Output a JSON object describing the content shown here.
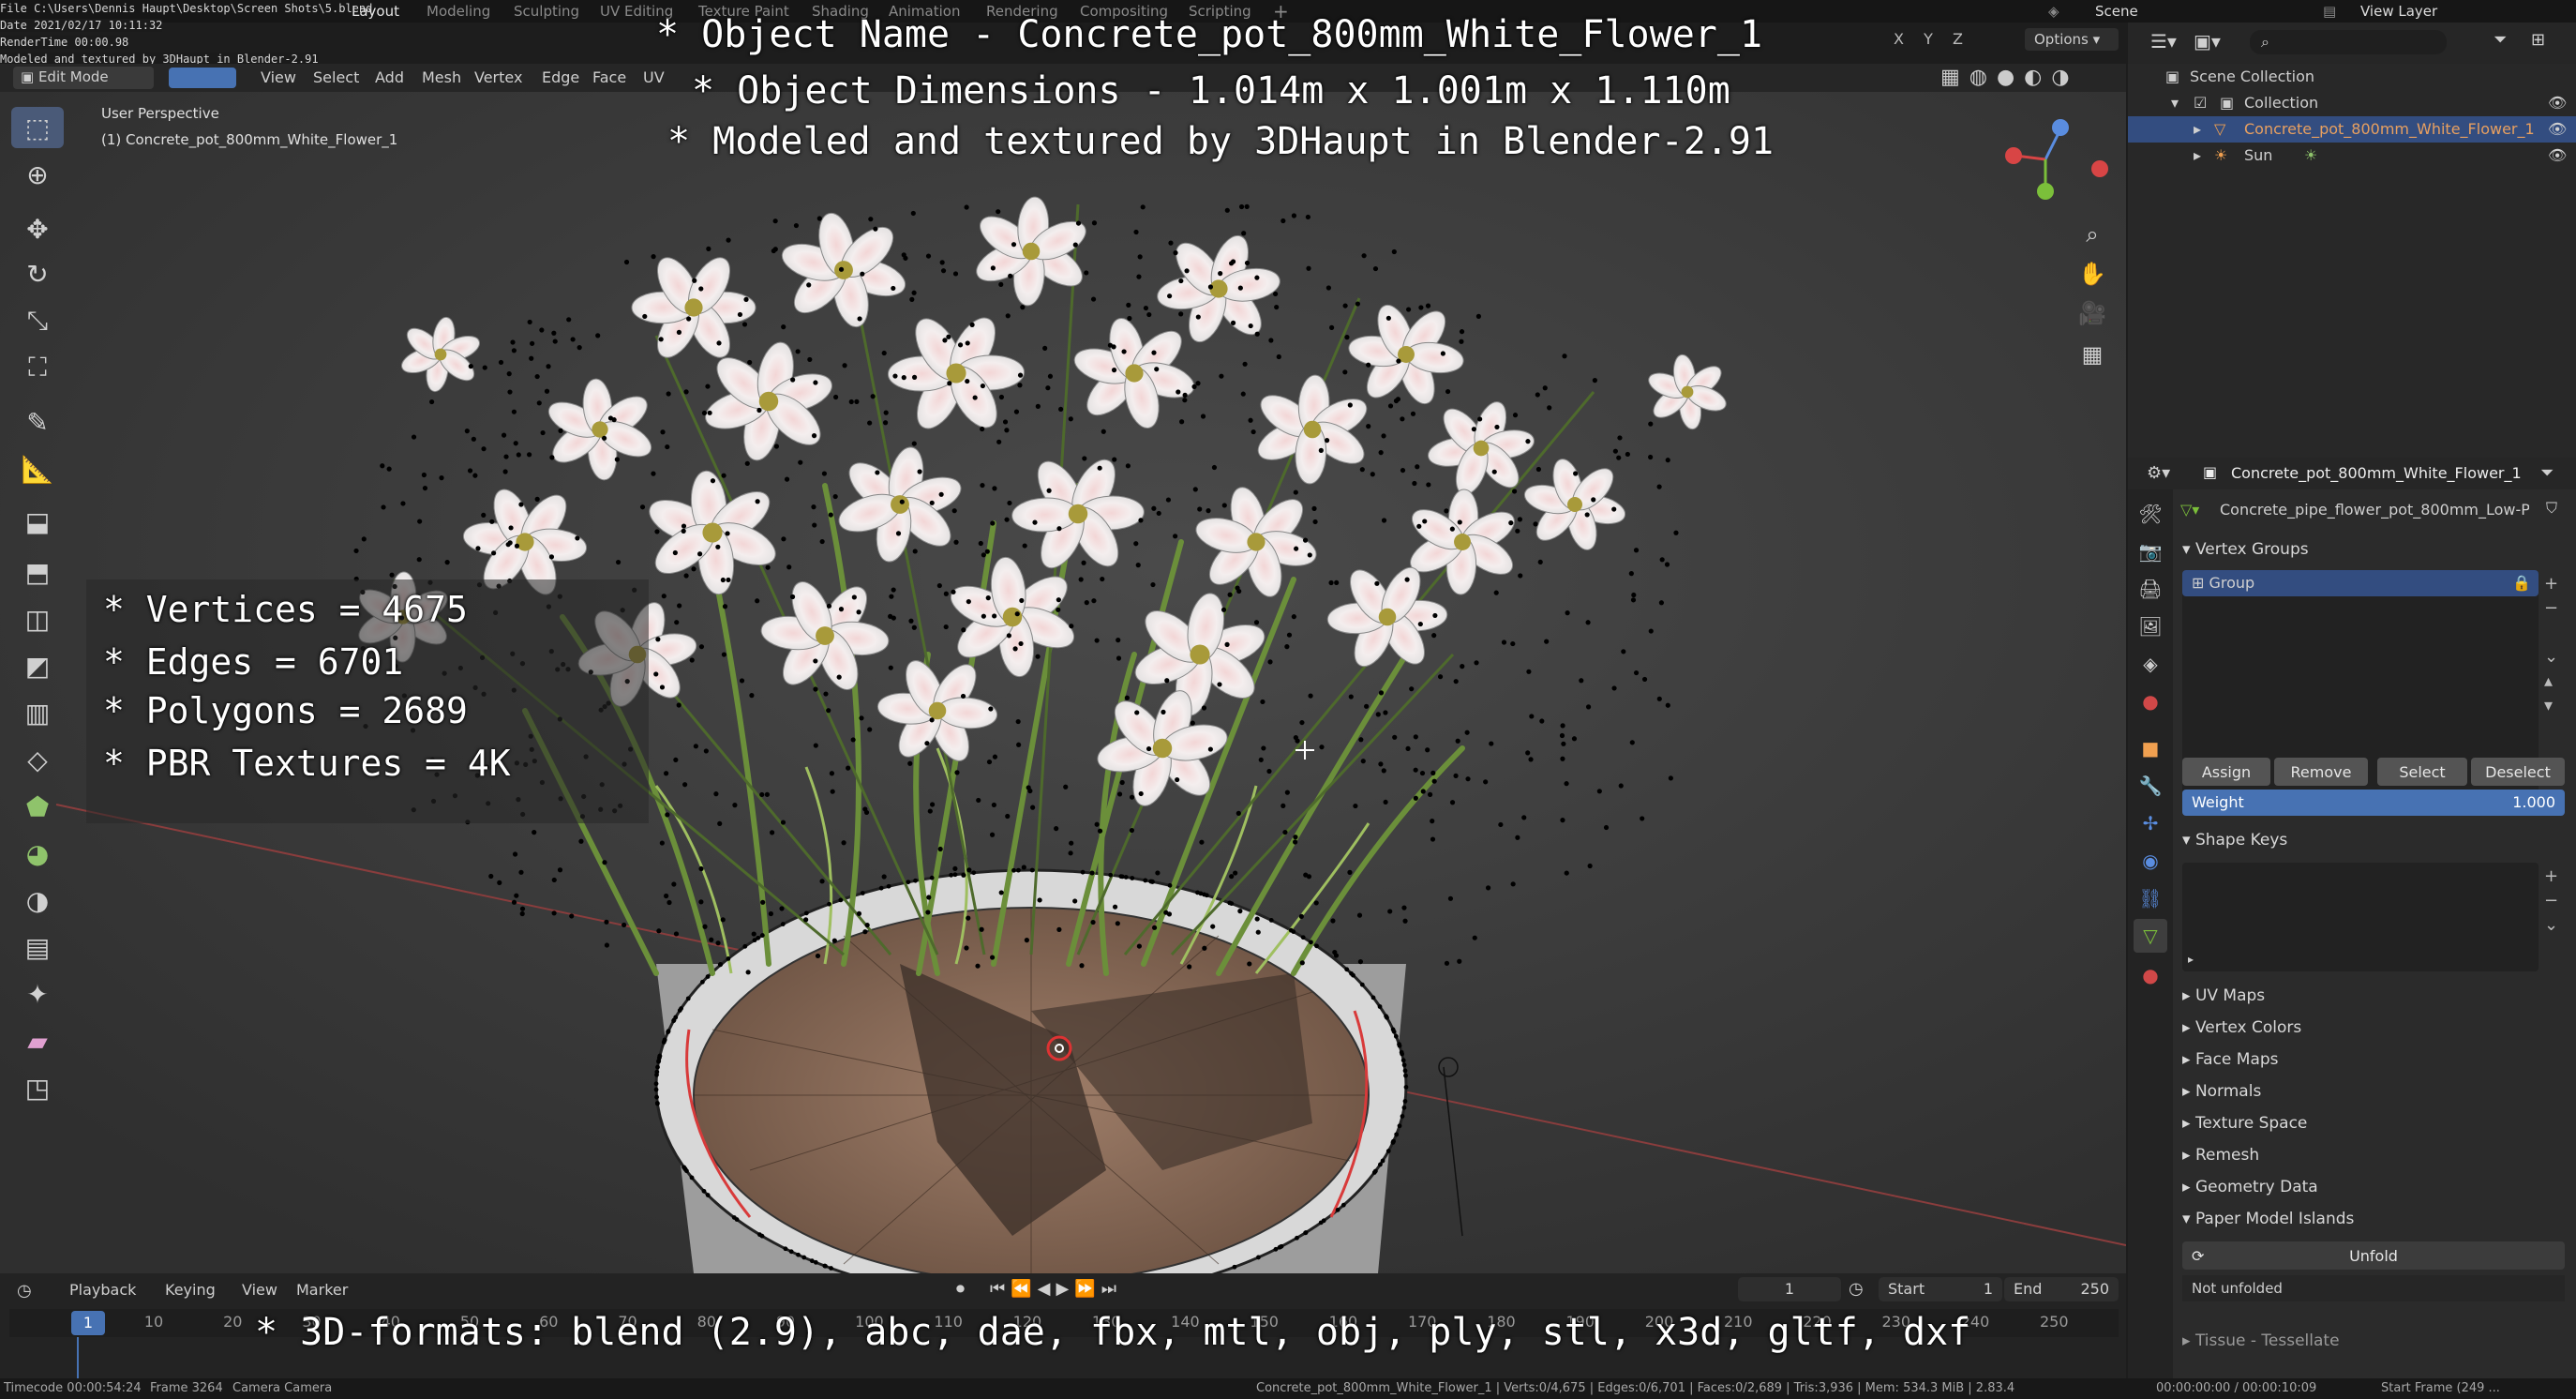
{
  "header": {
    "tabs": [
      "Layout",
      "Modeling",
      "Sculpting",
      "UV Editing",
      "Texture Paint",
      "Shading",
      "Animation",
      "Rendering",
      "Compositing",
      "Scripting"
    ],
    "active_tab": "Layout",
    "scene": "Scene",
    "view_layer": "View Layer",
    "options": "Options"
  },
  "stamp": {
    "file": "File C:\\Users\\Dennis Haupt\\Desktop\\Screen Shots\\5.blend",
    "date": "Date 2021/02/17 10:11:32",
    "render_time": "RenderTime 00:00.98",
    "note": "Modeled and textured by 3DHaupt in Blender-2.91"
  },
  "viewport_header": {
    "mode": "Edit Mode",
    "menus": [
      "View",
      "Select",
      "Add",
      "Mesh",
      "Vertex",
      "Edge",
      "Face",
      "UV"
    ],
    "axes": [
      "X",
      "Y",
      "Z"
    ]
  },
  "viewport": {
    "perspective": "User Perspective",
    "object_label": "(1) Concrete_pot_800mm_White_Flower_1"
  },
  "overlay": {
    "title_lines": [
      "* Object Name - Concrete_pot_800mm_White_Flower_1",
      "* Object Dimensions -  1.014m x 1.001m x 1.110m",
      "* Modeled and textured by 3DHaupt in Blender-2.91"
    ],
    "stats": [
      "* Vertices = 4675",
      "* Edges = 6701",
      "* Polygons = 2689",
      "* PBR Textures = 4K"
    ],
    "formats": "* 3D-formats: blend (2.9), abc, dae, fbx, mtl, obj, ply, stl, x3d, gltf, dxf"
  },
  "outliner": {
    "scene_collection": "Scene Collection",
    "collection": "Collection",
    "objects": [
      "Concrete_pot_800mm_White_Flower_1",
      "Sun"
    ]
  },
  "properties": {
    "object_name": "Concrete_pot_800mm_White_Flower_1",
    "mesh_name": "Concrete_pipe_flower_pot_800mm_Low-Po...",
    "vertex_groups": {
      "title": "Vertex Groups",
      "group": "Group",
      "buttons": [
        "Assign",
        "Remove",
        "Select",
        "Deselect"
      ],
      "weight_label": "Weight",
      "weight_value": "1.000"
    },
    "shape_keys": "Shape Keys",
    "collapsed_panels": [
      "UV Maps",
      "Vertex Colors",
      "Face Maps",
      "Normals",
      "Texture Space",
      "Remesh",
      "Geometry Data"
    ],
    "paper_model": {
      "title": "Paper Model Islands",
      "unfold": "Unfold",
      "status": "Not unfolded",
      "tissue": "Tissue - Tessellate"
    }
  },
  "timeline": {
    "menus": [
      "Playback",
      "Keying",
      "View",
      "Marker"
    ],
    "current_frame": "1",
    "start_label": "Start",
    "start": "1",
    "end_label": "End",
    "end": "250",
    "ticks": [
      "1",
      "10",
      "20",
      "30",
      "40",
      "50",
      "60",
      "70",
      "80",
      "90",
      "100",
      "110",
      "120",
      "130",
      "140",
      "150",
      "160",
      "170",
      "180",
      "190",
      "200",
      "210",
      "220",
      "230",
      "240",
      "250"
    ]
  },
  "status_bar": {
    "timecode": "Timecode 00:00:54:24",
    "frame": "Frame 3264",
    "camera": "Camera Camera",
    "stats": "Concrete_pot_800mm_White_Flower_1 | Verts:0/4,675 | Edges:0/6,701 | Faces:0/2,689 | Tris:3,936 | Mem: 534.3 MiB | 2.83.4",
    "time": "00:00:00:00 / 00:00:10:09",
    "start_frame": "Start Frame (249 ..."
  },
  "colors": {
    "accent": "#4772b3",
    "selected_row": "#334d80",
    "vertex": "#000000",
    "red_axis": "#c34545",
    "green_axis": "#76a52e"
  }
}
